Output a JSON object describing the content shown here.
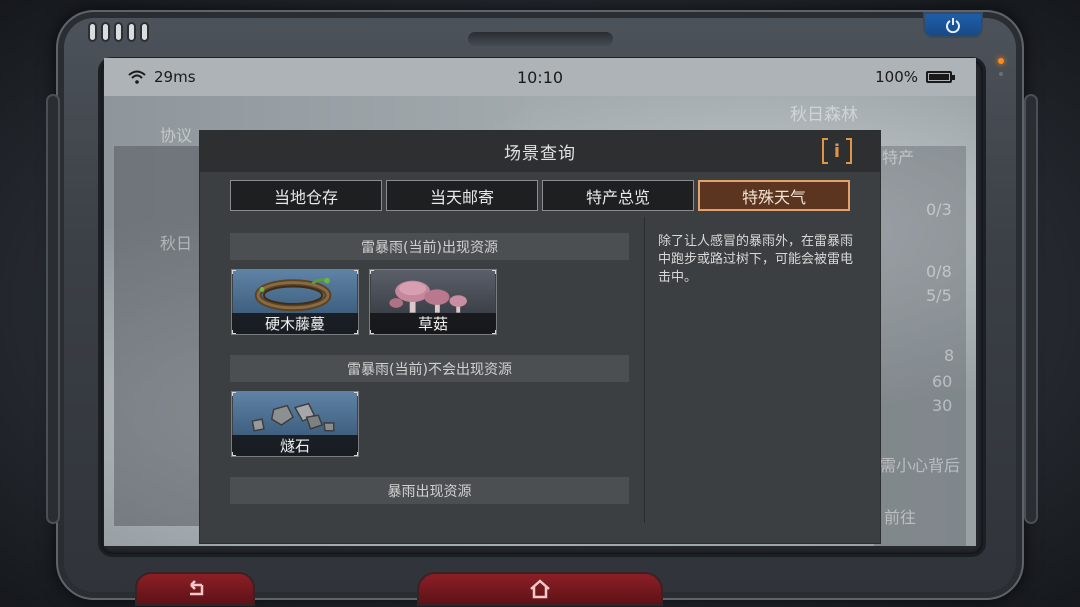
{
  "status_bar": {
    "signal_text": "29ms",
    "time": "10:10",
    "battery_text": "100%",
    "battery_level": 1.0
  },
  "background_hints": {
    "left_tab": "协议",
    "left_item": "秋日",
    "map_title": "秋日森林",
    "right_label": "特产",
    "right_values": [
      "0/3",
      "0/8",
      "5/5",
      "8",
      "60",
      "30"
    ],
    "right_bottom": "需小心背后",
    "bottom_text": "前往"
  },
  "dialog": {
    "title": "场景查询",
    "info_label": "i",
    "accent_color": "#e09447",
    "tabs": [
      {
        "label": "当地仓存",
        "active": false
      },
      {
        "label": "当天邮寄",
        "active": false
      },
      {
        "label": "特产总览",
        "active": false
      },
      {
        "label": "特殊天气",
        "active": true
      }
    ],
    "sections": [
      {
        "title": "雷暴雨(当前)出现资源",
        "items": [
          {
            "label": "硬木藤蔓",
            "icon": "vine-wreath-icon"
          },
          {
            "label": "草菇",
            "icon": "mushroom-icon"
          }
        ]
      },
      {
        "title": "雷暴雨(当前)不会出现资源",
        "items": [
          {
            "label": "燧石",
            "icon": "flint-stones-icon"
          }
        ]
      },
      {
        "title": "暴雨出现资源",
        "items": []
      }
    ],
    "description": "除了让人感冒的暴雨外，在雷暴雨中跑步或路过树下，可能会被雷电击中。"
  },
  "icons": {
    "power": "power-icon",
    "back": "back-arrow-icon",
    "home": "home-icon",
    "wifi": "wifi-icon",
    "battery": "battery-icon"
  }
}
